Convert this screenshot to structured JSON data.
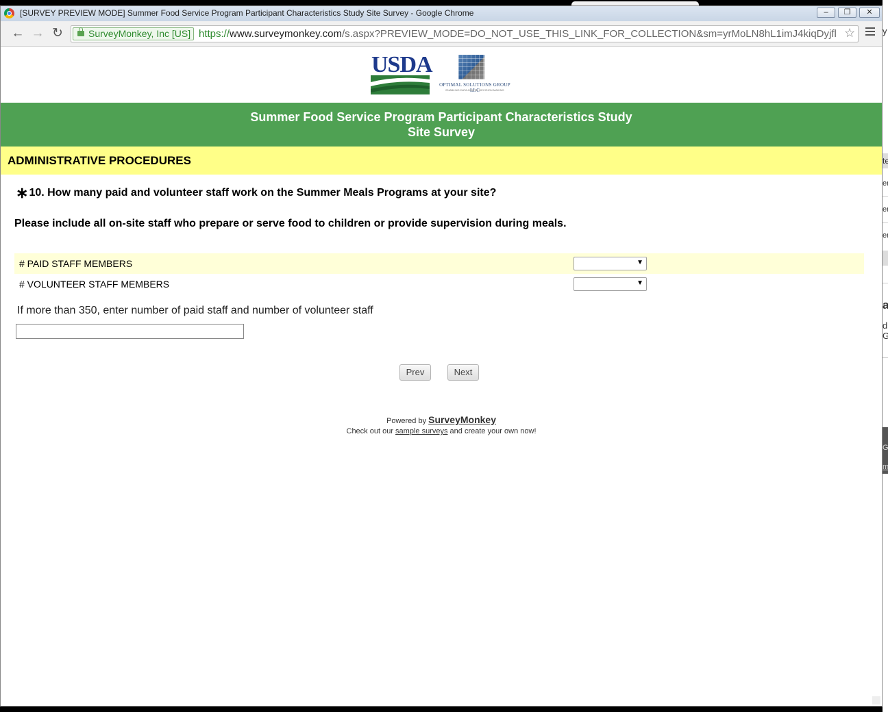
{
  "window": {
    "title": "[SURVEY PREVIEW MODE] Summer Food Service Program Participant Characteristics Study Site Survey - Google Chrome",
    "minimize_icon": "minimize-icon",
    "maximize_icon": "restore-icon",
    "close_icon": "close-icon",
    "minimize_label": "–",
    "maximize_label": "❐",
    "close_label": "✕"
  },
  "toolbar": {
    "back_label": "←",
    "forward_label": "→",
    "reload_label": "↻",
    "ev_label": "SurveyMonkey, Inc [US]",
    "url_scheme": "https://",
    "url_host": "www.surveymonkey.com",
    "url_path": "/s.aspx?PREVIEW_MODE=DO_NOT_USE_THIS_LINK_FOR_COLLECTION&sm=yrMoLN8hL1imJ4kiqDyjfl",
    "star_label": "☆"
  },
  "logos": {
    "usda": "USDA",
    "osg_name": "OPTIMAL SOLUTIONS GROUP LLC",
    "osg_tagline": "ENABLING DATA-DRIVEN DECISION MAKING"
  },
  "survey": {
    "title_line1": "Summer Food Service Program Participant Characteristics Study",
    "title_line2": "Site Survey",
    "section": "ADMINISTRATIVE PROCEDURES",
    "required_mark": "∗",
    "question": "10. How many paid and volunteer staff work on the Summer Meals Programs at your site?",
    "instructions": "Please include all on-site staff who prepare or serve food to children or provide supervision during meals.",
    "rows": [
      {
        "label": "# PAID STAFF MEMBERS",
        "selected": ""
      },
      {
        "label": "# VOLUNTEER STAFF MEMBERS",
        "selected": ""
      }
    ],
    "other_label": "If more than 350, enter number of paid staff and number of volunteer staff",
    "other_value": "",
    "prev_label": "Prev",
    "next_label": "Next"
  },
  "footer": {
    "powered_by": "Powered by",
    "brand": "SurveyMonkey",
    "sample_prefix": "Check out our",
    "sample_link": "sample surveys",
    "sample_suffix": "and create your own now!"
  },
  "background_window": {
    "fragments": [
      "y",
      "te",
      "er",
      "er",
      "er",
      "a",
      "d",
      "G",
      "G",
      "m"
    ]
  },
  "colors": {
    "header_green": "#4fa153",
    "section_yellow": "#ffff88",
    "row_highlight": "#ffffd8"
  }
}
